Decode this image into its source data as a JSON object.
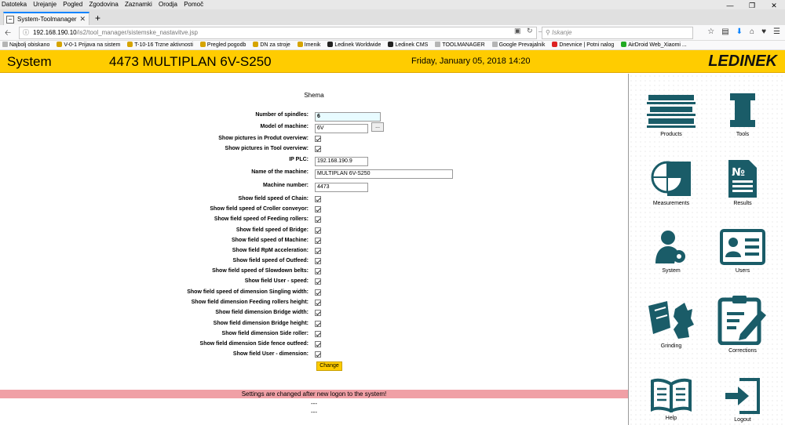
{
  "browser": {
    "menu": [
      "Datoteka",
      "Urejanje",
      "Pogled",
      "Zgodovina",
      "Zaznamki",
      "Orodja",
      "Pomoč"
    ],
    "tab_title": "System-Toolmanager",
    "url_host": "192.168.190.10",
    "url_path": "/is2/tool_manager/sistemske_nastavitve.jsp",
    "search_placeholder": "Iskanje",
    "bookmarks": [
      "Najbolj obiskano",
      "V-0-1 Prijava na sistem",
      "T-10-16 Trzne aktivnosti",
      "Pregled pogodb",
      "DN za stroje",
      "Imenik",
      "Ledinek Worldwide",
      "Ledinek CMS",
      "TOOLMANAGER",
      "Google Prevajalnik",
      "Dnevnice | Potni nalog",
      "AirDroid Web_Xiaomi ..."
    ]
  },
  "header": {
    "system_label": "System",
    "machine_title": "4473 MULTIPLAN 6V-S250",
    "datetime": "Friday, January 05, 2018 14:20",
    "logo": "LEDINEK"
  },
  "form": {
    "section_title": "Shema",
    "spindles_label": "Number of spindles:",
    "spindles_value": "6",
    "model_label": "Model of machine:",
    "model_value": "6V",
    "model_browse": "...",
    "pictures_product_label": "Show pictures in Produt overview:",
    "pictures_tool_label": "Show pictures in Tool overview:",
    "ip_label": "IP PLC:",
    "ip_value": "192.168.190.9",
    "name_label": "Name of the machine:",
    "name_value": "MULTIPLAN 6V-S250",
    "number_label": "Machine number:",
    "number_value": "4473",
    "fields": [
      "Show field speed of Chain:",
      "Show field speed of Croller conveyor:",
      "Show field speed of Feeding rollers:",
      "Show field speed of Bridge:",
      "Show field speed of Machine:",
      "Show field RpM acceleration:",
      "Show field speed of Outfeed:",
      "Show field speed of Slowdown belts:",
      "Show field User - speed:",
      "Show field speed of dimension Singling width:",
      "Show field dimension Feeding rollers height:",
      "Show field dimension Bridge width:",
      "Show field dimension Bridge height:",
      "Show field dimension Side roller:",
      "Show field dimension Side fence outfeed:",
      "Show field User - dimension:"
    ],
    "change_button": "Change"
  },
  "notice": "Settings are changed after new logon to the system!",
  "footer_dashes": [
    "---",
    "---"
  ],
  "sidebar": {
    "items": [
      {
        "label": "Products",
        "icon": "products-icon"
      },
      {
        "label": "Tools",
        "icon": "tools-icon"
      },
      {
        "label": "Measurements",
        "icon": "measurements-icon"
      },
      {
        "label": "Results",
        "icon": "results-icon"
      },
      {
        "label": "System",
        "icon": "system-icon"
      },
      {
        "label": "Users",
        "icon": "users-icon"
      },
      {
        "label": "Grinding",
        "icon": "grinding-icon"
      },
      {
        "label": "Corrections",
        "icon": "corrections-icon"
      },
      {
        "label": "Help",
        "icon": "help-icon"
      },
      {
        "label": "Logout",
        "icon": "logout-icon"
      }
    ]
  },
  "colors": {
    "brand_yellow": "#ffcc00",
    "icon_teal": "#1a5c68",
    "notice_pink": "#f0a0a6"
  }
}
